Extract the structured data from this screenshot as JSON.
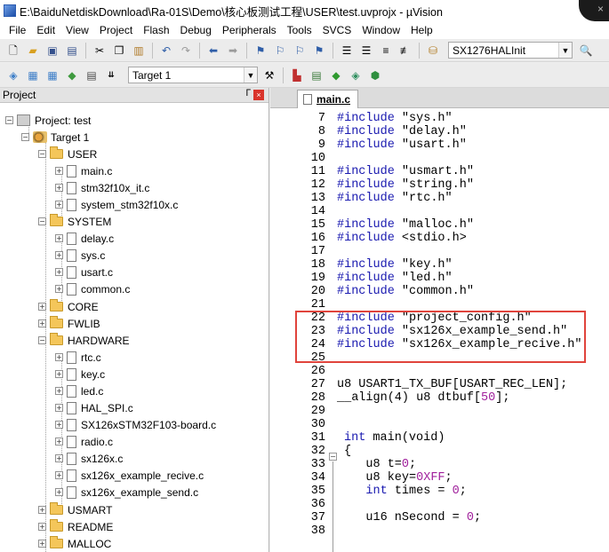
{
  "window": {
    "title": "E:\\BaiduNetdiskDownload\\Ra-01S\\Demo\\核心板测试工程\\USER\\test.uvprojx - µVision"
  },
  "menu": [
    "File",
    "Edit",
    "View",
    "Project",
    "Flash",
    "Debug",
    "Peripherals",
    "Tools",
    "SVCS",
    "Window",
    "Help"
  ],
  "toolbar": {
    "function_combo": "SX1276HALInit",
    "target_combo": "Target 1"
  },
  "project_panel": {
    "title": "Project",
    "root": "Project: test",
    "target": "Target 1",
    "groups": {
      "user": "USER",
      "user_files": [
        "main.c",
        "stm32f10x_it.c",
        "system_stm32f10x.c"
      ],
      "system": "SYSTEM",
      "system_files": [
        "delay.c",
        "sys.c",
        "usart.c",
        "common.c"
      ],
      "core": "CORE",
      "fwlib": "FWLIB",
      "hardware": "HARDWARE",
      "hardware_files": [
        "rtc.c",
        "key.c",
        "led.c",
        "HAL_SPI.c",
        "SX126xSTM32F103-board.c",
        "radio.c",
        "sx126x.c",
        "sx126x_example_recive.c",
        "sx126x_example_send.c"
      ],
      "usmart": "USMART",
      "readme": "README",
      "malloc": "MALLOC"
    }
  },
  "editor": {
    "tab": "main.c",
    "line_numbers": [
      "7",
      "8",
      "9",
      "10",
      "11",
      "12",
      "13",
      "14",
      "15",
      "16",
      "17",
      "18",
      "19",
      "20",
      "21",
      "22",
      "23",
      "24",
      "25",
      "26",
      "27",
      "28",
      "29",
      "30",
      "31",
      "32",
      "33",
      "34",
      "35",
      "36",
      "37",
      "38"
    ],
    "code": {
      "include_kw": "#include",
      "inc_7": "\"sys.h\"",
      "inc_8": "\"delay.h\"",
      "inc_9": "\"usart.h\"",
      "inc_11": "\"usmart.h\"",
      "inc_12": "\"string.h\"",
      "inc_13": "\"rtc.h\"",
      "inc_15": "\"malloc.h\"",
      "inc_16": "<stdio.h>",
      "inc_18": "\"key.h\"",
      "inc_19": "\"led.h\"",
      "inc_20": "\"common.h\"",
      "inc_22": "\"project_config.h\"",
      "inc_23": "\"sx126x_example_send.h\"",
      "inc_24": "\"sx126x_example_recive.h\"",
      "line_27": "u8 USART1_TX_BUF[USART_REC_LEN];",
      "line_28_a": "__align(4) u8 dtbuf[",
      "line_28_num": "50",
      "line_28_b": "];",
      "line_31_kw": "int",
      "line_31_rest": " main(void)",
      "line_32": "{",
      "line_33_a": "    u8 t=",
      "line_33_num": "0",
      "line_33_b": ";",
      "line_34_a": "    u8 key=",
      "line_34_num": "0XFF",
      "line_34_b": ";",
      "line_35_kw": "    int",
      "line_35_a": " times = ",
      "line_35_num": "0",
      "line_35_b": ";",
      "line_37_a": "    u16 nSecond = ",
      "line_37_num": "0",
      "line_37_b": ";"
    }
  },
  "colors": {
    "preprocessor": "#1a1ab0",
    "number": "#a0209c",
    "highlight_box": "#e0443c"
  }
}
